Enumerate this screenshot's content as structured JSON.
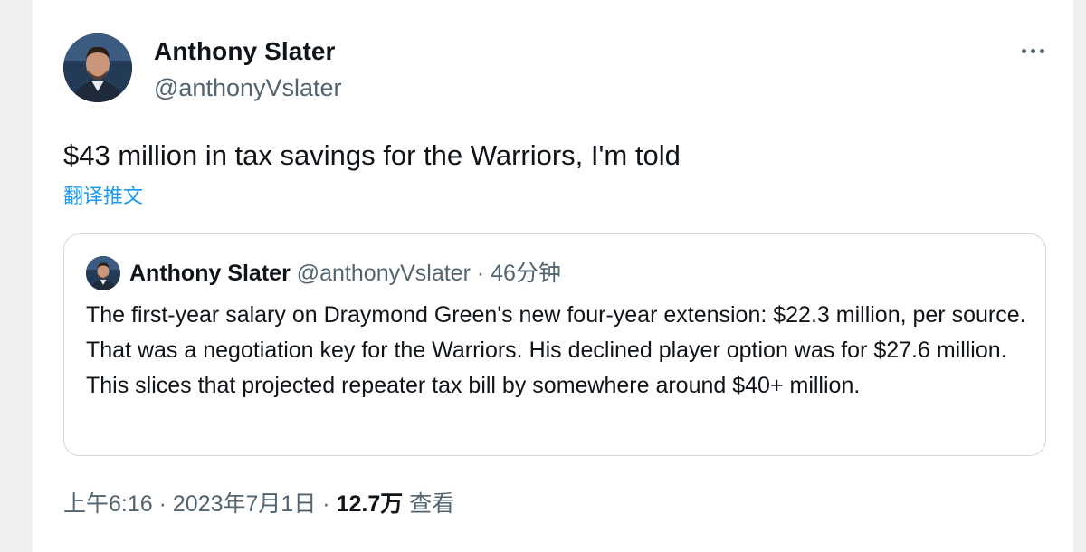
{
  "author": {
    "name": "Anthony Slater",
    "handle": "@anthonyVslater"
  },
  "tweet": {
    "text": "$43 million in tax savings for the Warriors, I'm told",
    "translate_label": "翻译推文"
  },
  "quoted_tweet": {
    "name": "Anthony Slater",
    "handle": "@anthonyVslater",
    "separator": "·",
    "time_ago": "46分钟",
    "text": "The first-year salary on Draymond Green's new four-year extension: $22.3 million, per source. That was a negotiation key for the Warriors. His declined player option was for $27.6 million. This slices that projected repeater tax bill by somewhere around $40+ million."
  },
  "footer": {
    "time": "上午6:16",
    "separator": "·",
    "date": "2023年7月1日",
    "views_count": "12.7万",
    "views_label": "查看"
  },
  "icons": {
    "more": "more-horizontal-icon"
  },
  "colors": {
    "accent": "#1d9bf0",
    "secondary_text": "#536471",
    "primary_text": "#0f1419",
    "border": "#cfd9de"
  }
}
